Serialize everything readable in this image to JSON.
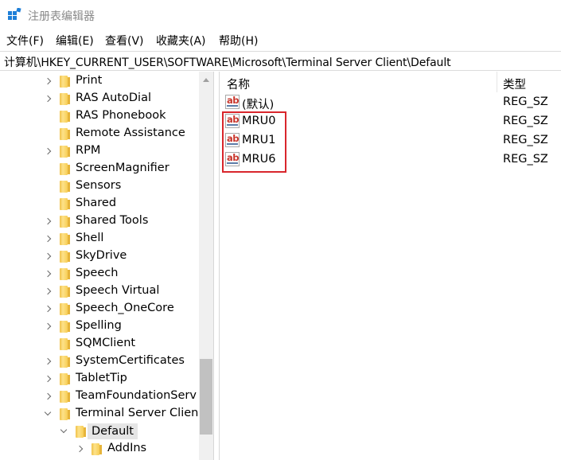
{
  "window": {
    "title": "注册表编辑器"
  },
  "menu": [
    "文件(F)",
    "编辑(E)",
    "查看(V)",
    "收藏夹(A)",
    "帮助(H)"
  ],
  "address": "计算机\\HKEY_CURRENT_USER\\SOFTWARE\\Microsoft\\Terminal Server Client\\Default",
  "tree": [
    {
      "label": "Print",
      "expander": "right"
    },
    {
      "label": "RAS AutoDial",
      "expander": "right"
    },
    {
      "label": "RAS Phonebook",
      "expander": "none"
    },
    {
      "label": "Remote Assistance",
      "expander": "none"
    },
    {
      "label": "RPM",
      "expander": "right"
    },
    {
      "label": "ScreenMagnifier",
      "expander": "none"
    },
    {
      "label": "Sensors",
      "expander": "none"
    },
    {
      "label": "Shared",
      "expander": "none"
    },
    {
      "label": "Shared Tools",
      "expander": "right"
    },
    {
      "label": "Shell",
      "expander": "right"
    },
    {
      "label": "SkyDrive",
      "expander": "right"
    },
    {
      "label": "Speech",
      "expander": "right"
    },
    {
      "label": "Speech Virtual",
      "expander": "right"
    },
    {
      "label": "Speech_OneCore",
      "expander": "right"
    },
    {
      "label": "Spelling",
      "expander": "right"
    },
    {
      "label": "SQMClient",
      "expander": "none"
    },
    {
      "label": "SystemCertificates",
      "expander": "right"
    },
    {
      "label": "TabletTip",
      "expander": "right"
    },
    {
      "label": "TeamFoundationServ",
      "expander": "right"
    },
    {
      "label": "Terminal Server Clien",
      "expander": "down"
    },
    {
      "label": "Default",
      "expander": "down",
      "selected": true
    },
    {
      "label": "AddIns",
      "expander": "right"
    }
  ],
  "list": {
    "columns": {
      "name": "名称",
      "type": "类型"
    },
    "icon_text": "ab",
    "rows": [
      {
        "name": "(默认)",
        "type": "REG_SZ"
      },
      {
        "name": "MRU0",
        "type": "REG_SZ"
      },
      {
        "name": "MRU1",
        "type": "REG_SZ"
      },
      {
        "name": "MRU6",
        "type": "REG_SZ"
      }
    ]
  }
}
